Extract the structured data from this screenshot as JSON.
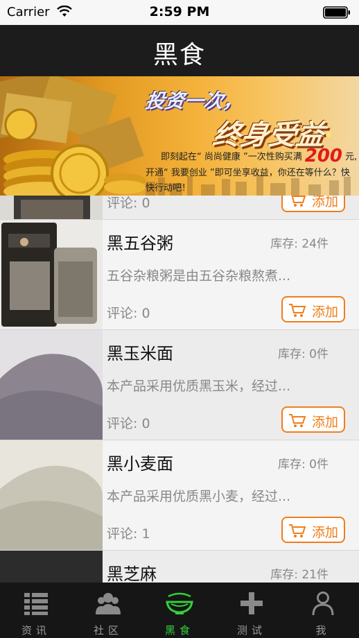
{
  "status_bar": {
    "carrier": "Carrier",
    "time": "2:59 PM"
  },
  "nav": {
    "title": "黑食"
  },
  "banner": {
    "slogan_1": "投资一次，",
    "slogan_2": "终身受益",
    "line_1_prefix": "即刻起在“ 尚尚健康 ”一次性购买满",
    "line_1_amount": "200",
    "line_1_suffix": "元,",
    "line_2": "开通“ 我要创业 ”即可坐享收益，你还在等什么？快",
    "line_3": "快行动吧！"
  },
  "products": [
    {
      "name": "",
      "stock": "",
      "desc": "",
      "comments": "评论: 0",
      "add_label": "添加"
    },
    {
      "name": "黑五谷粥",
      "stock": "库存: 24件",
      "desc": "五谷杂粮粥是由五谷杂粮熬煮...",
      "comments": "评论: 0",
      "add_label": "添加"
    },
    {
      "name": "黑玉米面",
      "stock": "库存: 0件",
      "desc": "本产品采用优质黑玉米，经过...",
      "comments": "评论: 0",
      "add_label": "添加"
    },
    {
      "name": "黑小麦面",
      "stock": "库存: 0件",
      "desc": "本产品采用优质黑小麦，经过...",
      "comments": "评论: 1",
      "add_label": "添加"
    },
    {
      "name": "黑芝麻",
      "stock": "库存: 21件",
      "desc": "",
      "comments": "",
      "add_label": ""
    }
  ],
  "tabs": [
    {
      "label": "资讯",
      "icon": "news-grid-icon",
      "active": false
    },
    {
      "label": "社区",
      "icon": "community-people-icon",
      "active": false
    },
    {
      "label": "黑食",
      "icon": "bowl-icon",
      "active": true
    },
    {
      "label": "测试",
      "icon": "plus-icon",
      "active": false
    },
    {
      "label": "我",
      "icon": "person-icon",
      "active": false
    }
  ],
  "colors": {
    "accent": "#f07d1a",
    "active_tab": "#33d13a",
    "nav_bg": "#1c1c1c"
  }
}
